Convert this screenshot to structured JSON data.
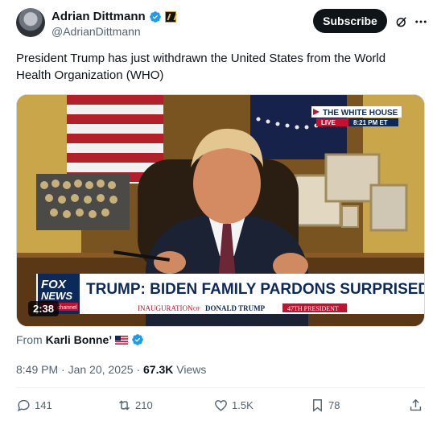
{
  "author": {
    "name": "Adrian Dittmann",
    "handle": "@AdrianDittmann",
    "subscribe_label": "Subscribe"
  },
  "icons": {
    "verified": "verified-badge-icon",
    "affiliation": "affiliation-badge-icon",
    "grok": "grok-icon",
    "more": "more-icon",
    "reply": "reply-icon",
    "retweet": "retweet-icon",
    "like": "like-icon",
    "bookmark": "bookmark-icon",
    "share": "share-icon"
  },
  "tweet": {
    "text": "President Trump has just withdrawn the United States from the World Health Organization (WHO)"
  },
  "video": {
    "duration": "2:38",
    "bug_title": "THE WHITE HOUSE",
    "bug_live": "LIVE",
    "bug_time": "8:21 PM ET",
    "network_line1": "FOX",
    "network_line2": "NEWS",
    "network_line3": "channel",
    "headline": "TRUMP: BIDEN FAMILY PARDONS SURPRISED ME",
    "subline_1": "INAUGURATION",
    "subline_of": "OF",
    "subline_2": "DONALD TRUMP",
    "subline_tag": "47TH PRESIDENT"
  },
  "attribution": {
    "prefix": "From",
    "name": "Karli Bonne’"
  },
  "meta": {
    "time": "8:49 PM",
    "separator": "·",
    "date": "Jan 20, 2025",
    "views_count": "67.3K",
    "views_label": "Views"
  },
  "stats": {
    "replies": "141",
    "reposts": "210",
    "likes": "1.5K",
    "bookmarks": "78"
  },
  "colors": {
    "text_primary": "#0f1419",
    "text_secondary": "#536471",
    "verified_blue": "#1d9bf0",
    "fox_red": "#c8102e",
    "fox_navy": "#0b2a5b"
  }
}
